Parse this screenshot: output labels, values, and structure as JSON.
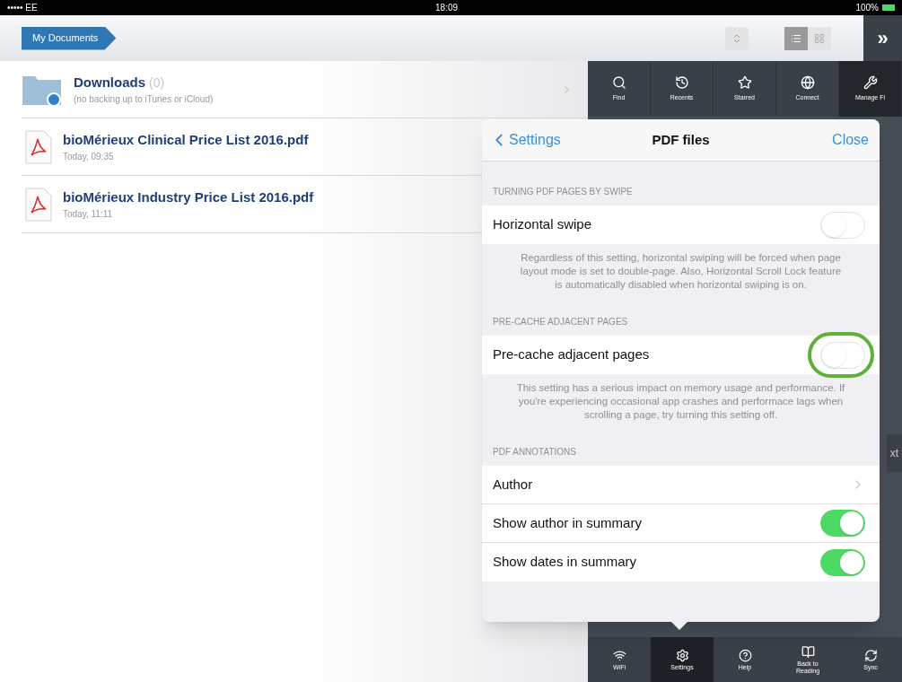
{
  "status_bar": {
    "carrier": "••••• EE",
    "time": "18:09",
    "battery": "100%"
  },
  "top_bar": {
    "breadcrumb": "My Documents",
    "more": "»",
    "views": [
      {
        "kind": "list",
        "selected": true
      },
      {
        "kind": "grid",
        "selected": false
      }
    ]
  },
  "files": [
    {
      "kind": "folder",
      "name": "Downloads",
      "count": "(0)",
      "subtitle": "(no backing up to iTunes or iCloud)"
    },
    {
      "kind": "pdf",
      "name": "bioMérieux Clinical Price List 2016.pdf",
      "subtitle": "Today, 09:35"
    },
    {
      "kind": "pdf",
      "name": "bioMérieux Industry Price List 2016.pdf",
      "subtitle": "Today, 11:11"
    }
  ],
  "top_tools": [
    {
      "label": "Find",
      "selected": false
    },
    {
      "label": "Recents",
      "selected": false
    },
    {
      "label": "Starred",
      "selected": false
    },
    {
      "label": "Connect",
      "selected": false
    },
    {
      "label": "Manage Fi",
      "selected": true
    }
  ],
  "side_fragment": "xt",
  "bottom_tools": [
    {
      "label": "WiFi",
      "selected": false
    },
    {
      "label": "Settings",
      "selected": true
    },
    {
      "label": "Help",
      "selected": false
    },
    {
      "label": "Back to Reading",
      "selected": false
    },
    {
      "label": "Sync",
      "selected": false
    }
  ],
  "popover": {
    "back": "Settings",
    "title": "PDF files",
    "close": "Close",
    "sections": [
      {
        "header": "TURNING PDF PAGES BY SWIPE",
        "rows": [
          {
            "kind": "toggle",
            "label": "Horizontal swipe",
            "on": false
          }
        ],
        "footer": "Regardless of this setting, horizontal swiping will be forced when page layout mode is set to double-page. Also, Horizontal Scroll Lock feature is automatically disabled when horizontal swiping is on."
      },
      {
        "header": "PRE-CACHE ADJACENT PAGES",
        "rows": [
          {
            "kind": "toggle",
            "label": "Pre-cache adjacent pages",
            "on": false,
            "highlighted": true
          }
        ],
        "footer": "This setting has a serious impact on memory usage and performance. If you're experiencing occasional app crashes and performace lags when scrolling a page, try turning this setting off."
      },
      {
        "header": "PDF ANNOTATIONS",
        "rows": [
          {
            "kind": "link",
            "label": "Author"
          },
          {
            "kind": "toggle",
            "label": "Show author in summary",
            "on": true
          },
          {
            "kind": "toggle",
            "label": "Show dates in summary",
            "on": true
          }
        ]
      }
    ]
  }
}
